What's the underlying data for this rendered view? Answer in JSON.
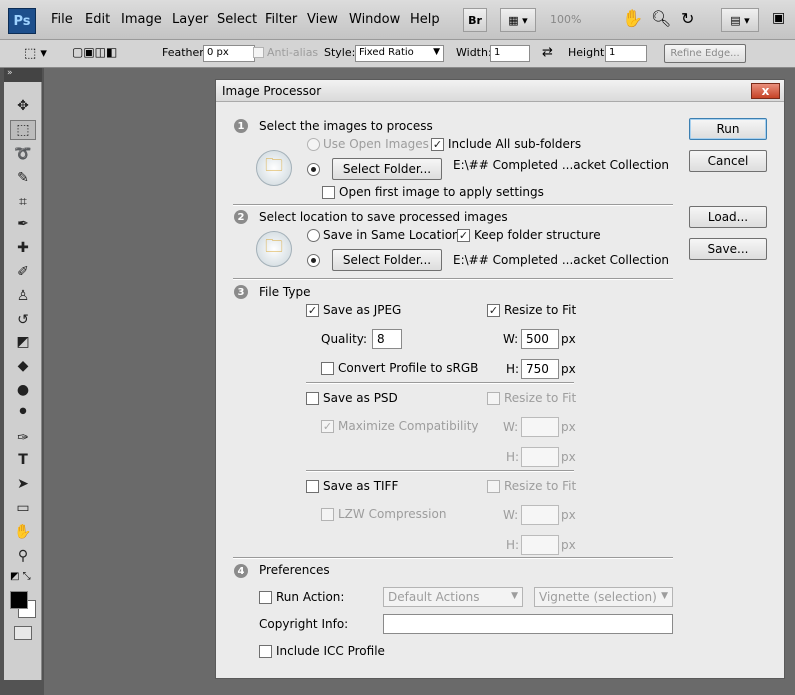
{
  "app": {
    "logo": "Ps",
    "menu": [
      "File",
      "Edit",
      "Image",
      "Layer",
      "Select",
      "Filter",
      "View",
      "Window",
      "Help"
    ],
    "bridge_label": "Br",
    "zoom": "100%"
  },
  "options": {
    "feather_label": "Feather:",
    "feather_value": "0 px",
    "antialias_label": "Anti-alias",
    "style_label": "Style:",
    "style_value": "Fixed Ratio",
    "width_label": "Width:",
    "width_value": "1",
    "height_label": "Height:",
    "height_value": "1",
    "refine_edge": "Refine Edge..."
  },
  "dialog": {
    "title": "Image Processor",
    "close": "x",
    "buttons": {
      "run": "Run",
      "cancel": "Cancel",
      "load": "Load...",
      "save": "Save..."
    },
    "s1": {
      "num": "1",
      "title": "Select the images to process",
      "use_open": "Use Open Images",
      "include_sub": "Include All sub-folders",
      "select_folder": "Select Folder...",
      "path": "E:\\## Completed ...acket Collection",
      "open_first": "Open first image to apply settings"
    },
    "s2": {
      "num": "2",
      "title": "Select location to save processed images",
      "same_loc": "Save in Same Location",
      "keep_struct": "Keep folder structure",
      "select_folder": "Select Folder...",
      "path": "E:\\## Completed ...acket Collection"
    },
    "s3": {
      "num": "3",
      "title": "File Type",
      "jpeg": "Save as JPEG",
      "resize": "Resize to Fit",
      "quality_label": "Quality:",
      "quality_value": "8",
      "w_label": "W:",
      "w_value": "500",
      "px": "px",
      "srgb": "Convert Profile to sRGB",
      "h_label": "H:",
      "h_value": "750",
      "psd": "Save as PSD",
      "max_compat": "Maximize Compatibility",
      "tiff": "Save as TIFF",
      "lzw": "LZW Compression"
    },
    "s4": {
      "num": "4",
      "title": "Preferences",
      "run_action": "Run Action:",
      "action_set": "Default Actions",
      "action": "Vignette (selection)",
      "copyright": "Copyright Info:",
      "icc": "Include ICC Profile"
    }
  }
}
